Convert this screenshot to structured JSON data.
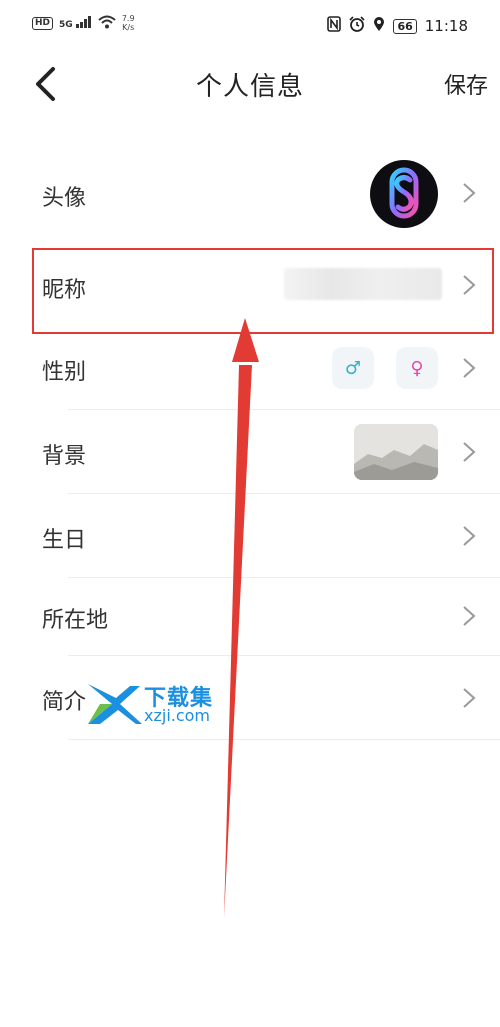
{
  "status_bar": {
    "hd": "HD",
    "signal": "5G",
    "net_speed_value": "7.9",
    "net_speed_unit": "K/s",
    "battery": "66",
    "time": "11:18"
  },
  "header": {
    "title": "个人信息",
    "save_label": "保存"
  },
  "rows": {
    "avatar": {
      "label": "头像"
    },
    "nickname": {
      "label": "昵称"
    },
    "gender": {
      "label": "性别",
      "male_symbol": "♂",
      "female_symbol": "♀"
    },
    "background": {
      "label": "背景"
    },
    "birthday": {
      "label": "生日"
    },
    "location": {
      "label": "所在地"
    },
    "bio": {
      "label": "简介"
    }
  },
  "watermark": {
    "cn": "下载集",
    "en": "xzji.com"
  },
  "colors": {
    "highlight": "#e23b34",
    "male": "#2bb3c9",
    "female": "#e24aa6",
    "watermark": "#1b8fe0"
  }
}
